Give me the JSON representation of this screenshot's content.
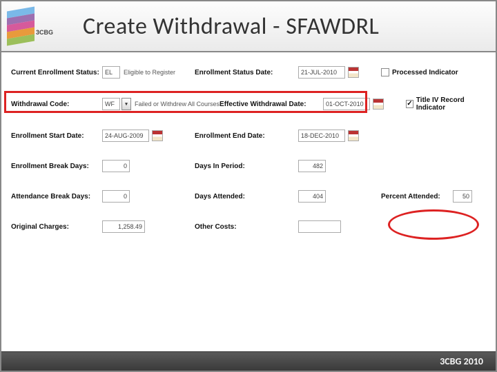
{
  "header": {
    "logo_text": "3CBG",
    "title": "Create Withdrawal  - SFAWDRL"
  },
  "form": {
    "row1": {
      "label1": "Current Enrollment Status:",
      "code": "EL",
      "code_desc": "Eligible to Register",
      "label2": "Enrollment Status Date:",
      "date": "21-JUL-2010",
      "check_label": "Processed Indicator",
      "checked": false
    },
    "row2": {
      "label1": "Withdrawal Code:",
      "code": "WF",
      "code_desc": "Failed or Withdrew All Courses",
      "label2": "Effective Withdrawal Date:",
      "date": "01-OCT-2010",
      "check_label": "Title IV Record Indicator",
      "checked": true
    },
    "row3": {
      "label1": "Enrollment Start Date:",
      "date1": "24-AUG-2009",
      "label2": "Enrollment End Date:",
      "date2": "18-DEC-2010"
    },
    "row4": {
      "label1": "Enrollment Break Days:",
      "val1": "0",
      "label2": "Days In Period:",
      "val2": "482"
    },
    "row5": {
      "label1": "Attendance Break Days:",
      "val1": "0",
      "label2": "Days Attended:",
      "val2": "404",
      "label3": "Percent Attended:",
      "val3": "50"
    },
    "row6": {
      "label1": "Original Charges:",
      "val1": "1,258.49",
      "label2": "Other Costs:",
      "val2": ""
    }
  },
  "footer": {
    "text": "3CBG 2010"
  }
}
